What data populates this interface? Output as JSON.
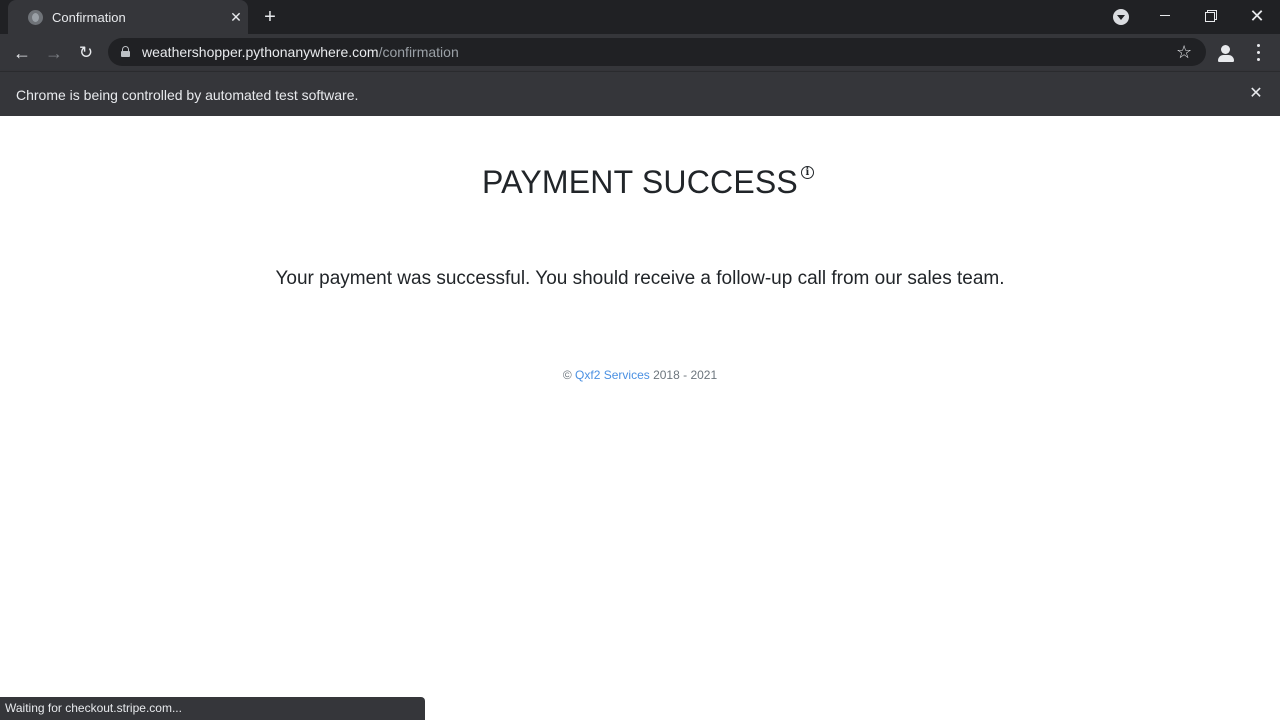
{
  "browser": {
    "tab_title": "Confirmation",
    "url_host": "weathershopper.pythonanywhere.com",
    "url_path": "/confirmation",
    "infobar_text": "Chrome is being controlled by automated test software.",
    "status_text": "Waiting for checkout.stripe.com..."
  },
  "page": {
    "heading": "PAYMENT SUCCESS",
    "info_glyph": "i",
    "message": "Your payment was successful. You should receive a follow-up call from our sales team.",
    "footer": {
      "copyright": "© ",
      "link_text": "Qxf2 Services",
      "years": " 2018 - 2021"
    }
  },
  "colors": {
    "browser_dark": "#202124",
    "toolbar": "#35363a",
    "link": "#4a90e2",
    "text": "#212529"
  }
}
